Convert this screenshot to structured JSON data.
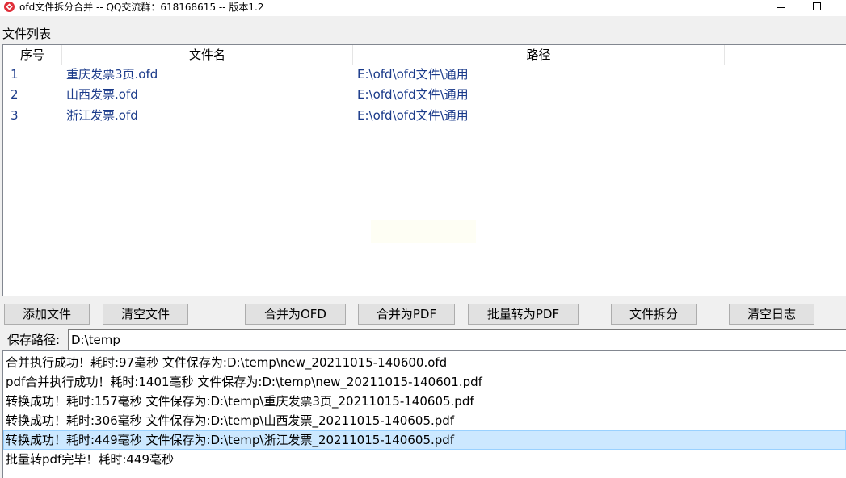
{
  "window": {
    "title": "ofd文件拆分合并 -- QQ交流群：618168615 -- 版本1.2",
    "icon": "app-logo-icon",
    "controls": [
      "minimize-icon",
      "maximize-icon"
    ]
  },
  "file_list": {
    "label": "文件列表",
    "columns": [
      "序号",
      "文件名",
      "路径"
    ],
    "rows": [
      {
        "index": "1",
        "name": "重庆发票3页.ofd",
        "path": "E:\\ofd\\ofd文件\\通用"
      },
      {
        "index": "2",
        "name": "山西发票.ofd",
        "path": "E:\\ofd\\ofd文件\\通用"
      },
      {
        "index": "3",
        "name": "浙江发票.ofd",
        "path": "E:\\ofd\\ofd文件\\通用"
      }
    ]
  },
  "toolbar": {
    "add_files": "添加文件",
    "clear_files": "清空文件",
    "merge_ofd": "合并为OFD",
    "merge_pdf": "合并为PDF",
    "batch_pdf": "批量转为PDF",
    "split_file": "文件拆分",
    "clear_log": "清空日志"
  },
  "save": {
    "label": "保存路径:",
    "value": "D:\\temp"
  },
  "log": {
    "entries": [
      "合并执行成功！耗时:97毫秒 文件保存为:D:\\temp\\new_20211015-140600.ofd",
      "pdf合并执行成功！耗时:1401毫秒 文件保存为:D:\\temp\\new_20211015-140601.pdf",
      "转换成功！耗时:157毫秒 文件保存为:D:\\temp\\重庆发票3页_20211015-140605.pdf",
      "转换成功！耗时:306毫秒 文件保存为:D:\\temp\\山西发票_20211015-140605.pdf",
      "转换成功！耗时:449毫秒 文件保存为:D:\\temp\\浙江发票_20211015-140605.pdf",
      "批量转pdf完毕！耗时:449毫秒"
    ],
    "selected_index": 4
  },
  "colors": {
    "row_text": "#1a3a8a",
    "selection_bg": "#cce8ff",
    "app_icon": "#e0303a"
  }
}
